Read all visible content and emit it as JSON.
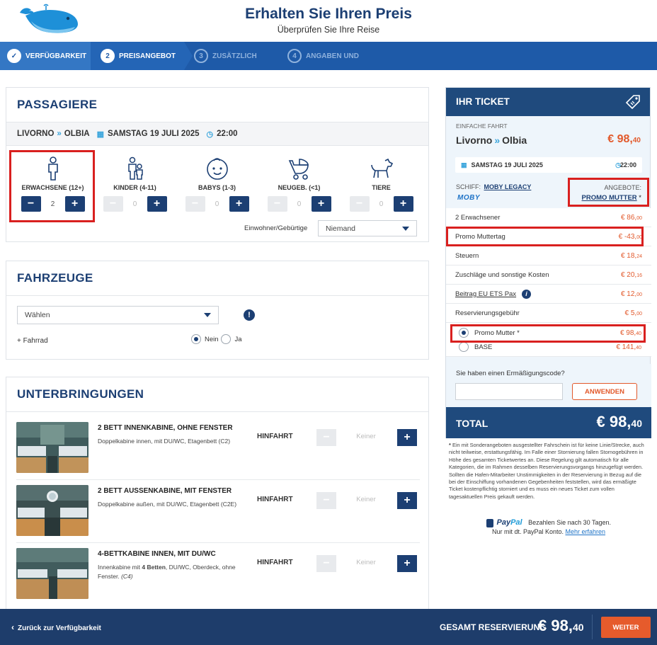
{
  "header": {
    "title": "Erhalten Sie Ihren Preis",
    "subtitle": "Überprüfen Sie Ihre Reise"
  },
  "steps": [
    {
      "num": "✓",
      "label": "VERFÜGBARKEIT",
      "state": "done"
    },
    {
      "num": "2",
      "label": "PREISANGEBOT",
      "state": "active"
    },
    {
      "num": "3",
      "label": "ZUSÄTZLICH",
      "state": "future"
    },
    {
      "num": "4",
      "label": "ANGABEN UND",
      "state": "future"
    }
  ],
  "passengers": {
    "title": "PASSAGIERE",
    "route_from": "LIVORNO",
    "route_to": "OLBIA",
    "date": "SAMSTAG 19 JULI 2025",
    "time": "22:00",
    "types": [
      {
        "label": "ERWACHSENE (12+)",
        "value": "2",
        "icon": "adult-icon",
        "enabled": true
      },
      {
        "label": "KINDER (4-11)",
        "value": "0",
        "icon": "children-icon",
        "enabled": false
      },
      {
        "label": "BABYS (1-3)",
        "value": "0",
        "icon": "baby-icon",
        "enabled": false
      },
      {
        "label": "NEUGEB. (<1)",
        "value": "0",
        "icon": "stroller-icon",
        "enabled": false
      },
      {
        "label": "TIERE",
        "value": "0",
        "icon": "dog-icon",
        "enabled": false
      }
    ],
    "resident_label": "Einwohner/Gebürtige",
    "resident_value": "Niemand"
  },
  "vehicles": {
    "title": "FAHRZEUGE",
    "select_value": "Wählen",
    "bike_label": "+ Fahrrad",
    "no_label": "Nein",
    "yes_label": "Ja"
  },
  "accommodations": {
    "title": "UNTERBRINGUNGEN",
    "direction_label": "HINFAHRT",
    "none_label": "Keiner",
    "cabins": [
      {
        "name": "2 BETT INNENKABINE, OHNE FENSTER",
        "desc": "Doppelkabine innen, mit DU/WC, Etagenbett (C2)"
      },
      {
        "name": "2 BETT AUSSENKABINE, MIT FENSTER",
        "desc": "Doppelkabine außen, mit DU/WC, Etagenbett (C2E)"
      },
      {
        "name": "4-BETTKABINE INNEN, MIT DU/WC",
        "desc_a": "Innenkabine mit ",
        "desc_b": "4 Betten",
        "desc_c": ", DU/WC, Oberdeck, ohne Fenster. ",
        "desc_d": "(C4)"
      }
    ]
  },
  "ticket": {
    "title": "IHR TICKET",
    "type_label": "EINFACHE FAHRT",
    "route_from": "Livorno",
    "route_to": "Olbia",
    "price_main": "€ 98,",
    "price_cents": "40",
    "date": "SAMSTAG 19 JULI 2025",
    "time": "22:00",
    "ship_label": "SCHIFF:",
    "ship_name": "MOBY LEGACY",
    "ship_brand": "MOBY",
    "offers_label": "ANGEBOTE:",
    "offer_name": "PROMO MUTTER",
    "offer_star": "*",
    "lines": [
      {
        "label": "2 Erwachsener",
        "amt": "€ 86,",
        "cents": "00"
      },
      {
        "label": "Promo Muttertag",
        "amt": "€ -43,",
        "cents": "00"
      },
      {
        "label": "Steuern",
        "amt": "€ 18,",
        "cents": "24"
      },
      {
        "label": "Zuschläge und sonstige Kosten",
        "amt": "€ 20,",
        "cents": "16"
      },
      {
        "label": "Beitrag EU ETS Pax",
        "amt": "€ 12,",
        "cents": "00"
      },
      {
        "label": "Reservierungsgebühr",
        "amt": "€ 5,",
        "cents": "00"
      }
    ],
    "fare_options": [
      {
        "label": "Promo Mutter *",
        "amt": "€ 98,",
        "cents": "40",
        "selected": true
      },
      {
        "label": "BASE",
        "amt": "€ 141,",
        "cents": "40",
        "selected": false
      }
    ],
    "discount_question": "Sie haben einen Ermäßigungscode?",
    "discount_placeholder": "",
    "apply_label": "ANWENDEN",
    "total_label": "TOTAL",
    "total_main": "€ 98,",
    "total_cents": "40"
  },
  "fineprint": {
    "star": "*",
    "text": "Ein mit Sonderangeboten ausgestellter Fahrschein ist für keine Linie/Strecke, auch nicht teilweise, erstattungsfähig. Im Falle einer Stornierung fallen Stornogebühren in Höhe des gesamten Ticketwertes an. Diese Regelung gilt automatisch für alle Kategorien, die im Rahmen desselben Reservierungsvorgangs hinzugefügt werden. Sollten die Hafen-Mitarbeiter Unstimmigkeiten in der Reservierung in Bezug auf die bei der Einschiffung vorhandenen Gegebenheiten feststellen, wird das ermäßigte Ticket kostenpflichtig storniert und es muss ein neues Ticket zum vollen tagesaktuellen Preis gekauft werden."
  },
  "paypal": {
    "brand_a": "Pay",
    "brand_b": "Pal",
    "line1": "Bezahlen Sie nach 30 Tagen.",
    "line2": "Nur mit dt. PayPal Konto.",
    "link": "Mehr erfahren"
  },
  "footer": {
    "back_label": "Zurück zur Verfügbarkeit",
    "total_label": "GESAMT RESERVIERUNG",
    "total_main": "€ 98,",
    "total_cents": "40",
    "next_label": "WEITER"
  },
  "colors": {
    "brand_navy": "#1c3f73",
    "step_blue": "#1e5aa8",
    "price_orange": "#e2592b",
    "highlight_red": "#d9201f"
  }
}
